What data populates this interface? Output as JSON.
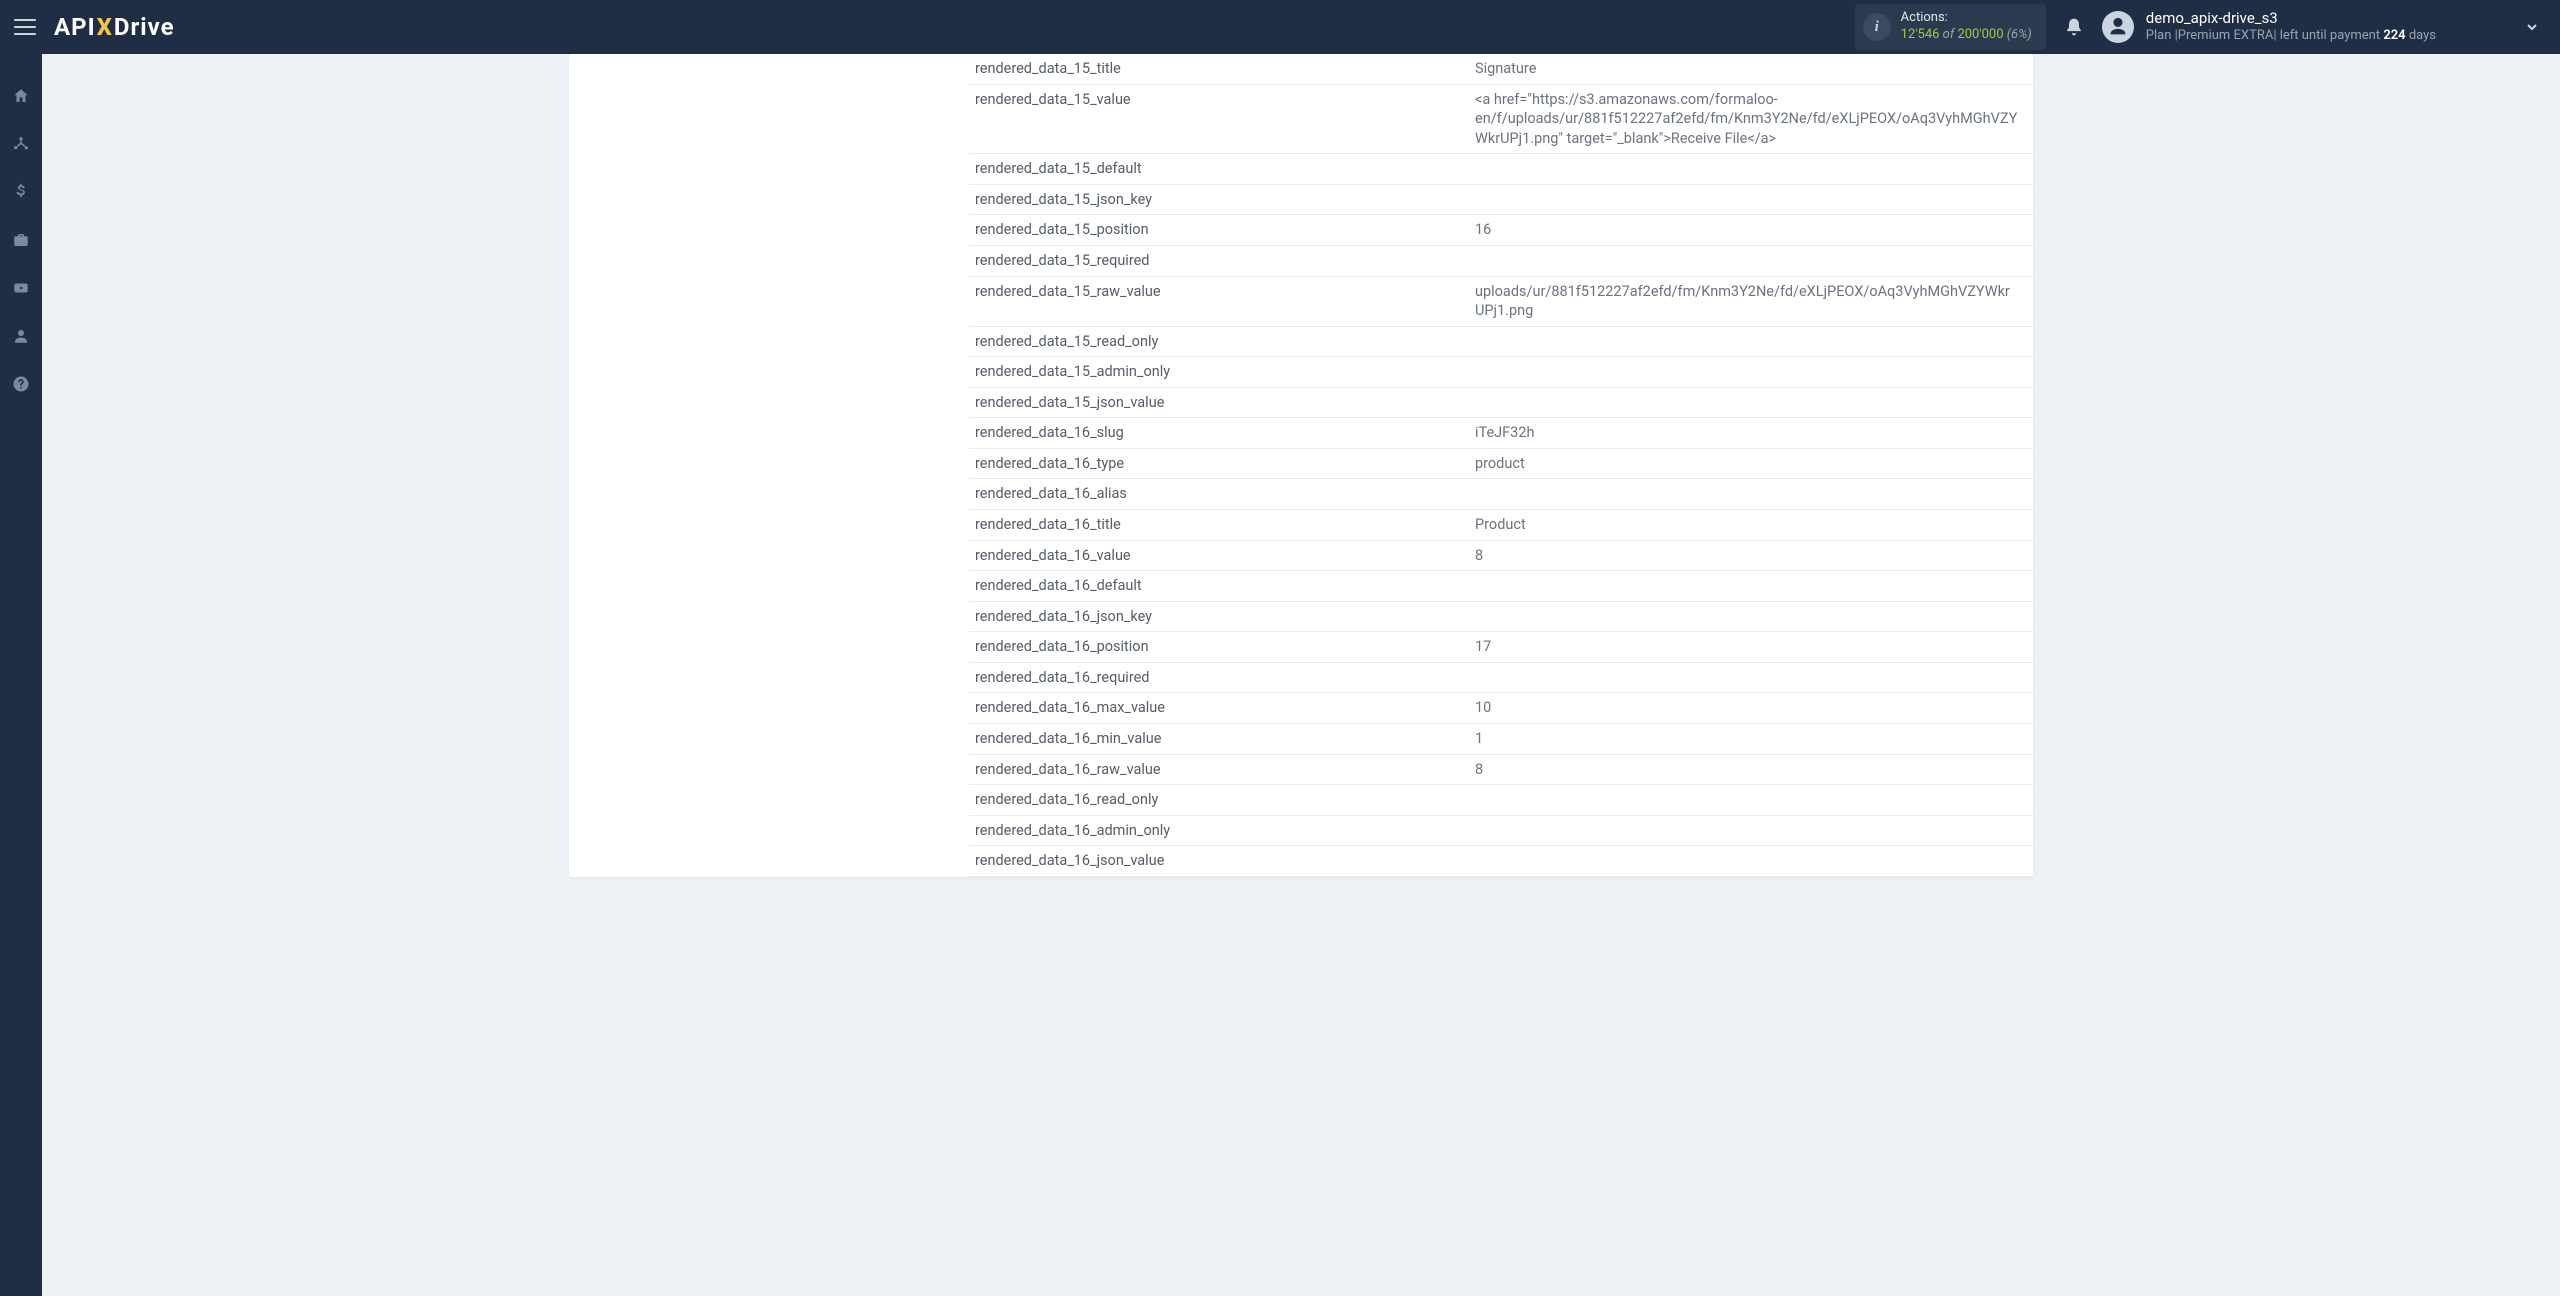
{
  "header": {
    "logo_api": "API",
    "logo_x": "X",
    "logo_drive": "Drive",
    "actions_label": "Actions:",
    "actions_current": "12'546",
    "actions_of": " of ",
    "actions_max": "200'000",
    "actions_pct": " (6%)",
    "user_name": "demo_apix-drive_s3",
    "plan_prefix": "Plan |",
    "plan_name": "Premium EXTRA",
    "plan_mid": "| left until payment ",
    "plan_days": "224",
    "plan_suffix": " days"
  },
  "rows": [
    {
      "key": "rendered_data_15_title",
      "val": "Signature"
    },
    {
      "key": "rendered_data_15_value",
      "val": "<a href=\"https://s3.amazonaws.com/formaloo-en/f/uploads/ur/881f512227af2efd/fm/Knm3Y2Ne/fd/eXLjPEOX/oAq3VyhMGhVZYWkrUPj1.png\" target=\"_blank\">Receive File</a>"
    },
    {
      "key": "rendered_data_15_default",
      "val": ""
    },
    {
      "key": "rendered_data_15_json_key",
      "val": ""
    },
    {
      "key": "rendered_data_15_position",
      "val": "16"
    },
    {
      "key": "rendered_data_15_required",
      "val": ""
    },
    {
      "key": "rendered_data_15_raw_value",
      "val": "uploads/ur/881f512227af2efd/fm/Knm3Y2Ne/fd/eXLjPEOX/oAq3VyhMGhVZYWkrUPj1.png"
    },
    {
      "key": "rendered_data_15_read_only",
      "val": ""
    },
    {
      "key": "rendered_data_15_admin_only",
      "val": ""
    },
    {
      "key": "rendered_data_15_json_value",
      "val": ""
    },
    {
      "key": "rendered_data_16_slug",
      "val": "iTeJF32h"
    },
    {
      "key": "rendered_data_16_type",
      "val": "product"
    },
    {
      "key": "rendered_data_16_alias",
      "val": ""
    },
    {
      "key": "rendered_data_16_title",
      "val": "Product"
    },
    {
      "key": "rendered_data_16_value",
      "val": "8"
    },
    {
      "key": "rendered_data_16_default",
      "val": ""
    },
    {
      "key": "rendered_data_16_json_key",
      "val": ""
    },
    {
      "key": "rendered_data_16_position",
      "val": "17"
    },
    {
      "key": "rendered_data_16_required",
      "val": ""
    },
    {
      "key": "rendered_data_16_max_value",
      "val": "10"
    },
    {
      "key": "rendered_data_16_min_value",
      "val": "1"
    },
    {
      "key": "rendered_data_16_raw_value",
      "val": "8"
    },
    {
      "key": "rendered_data_16_read_only",
      "val": ""
    },
    {
      "key": "rendered_data_16_admin_only",
      "val": ""
    },
    {
      "key": "rendered_data_16_json_value",
      "val": ""
    }
  ]
}
